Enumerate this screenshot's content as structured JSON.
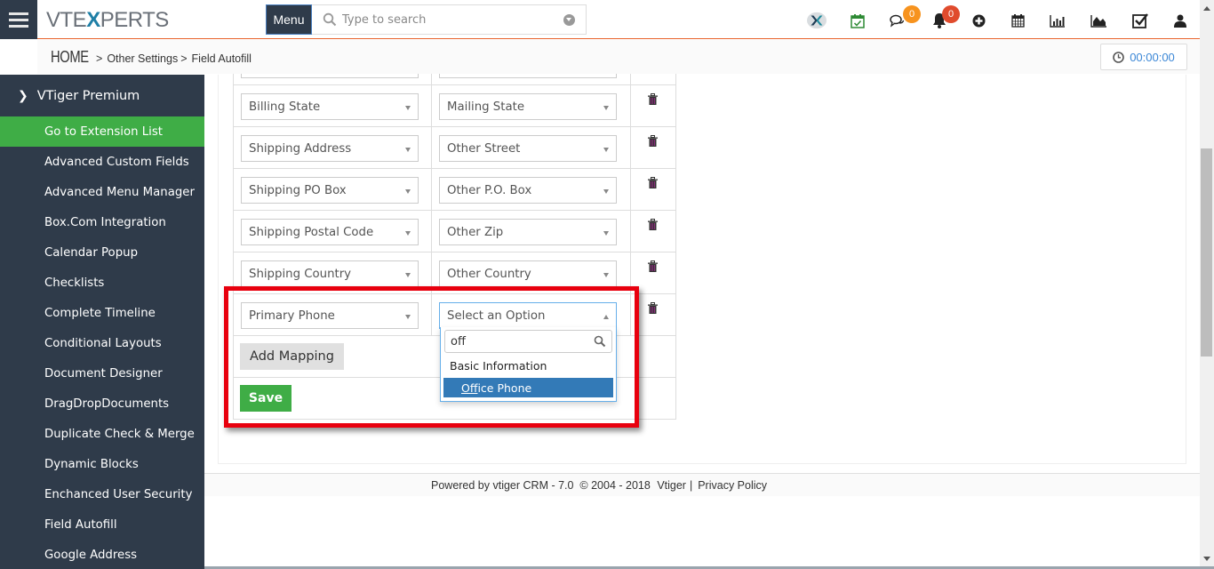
{
  "header": {
    "logo_prefix": "VTE",
    "logo_x": "X",
    "logo_suffix": "PERTS",
    "menu_label": "Menu",
    "search_placeholder": "Type to search",
    "icons": [
      {
        "name": "vtexperts-icon"
      },
      {
        "name": "calendar-check-icon"
      },
      {
        "name": "chat-icon",
        "badge": "0",
        "badge_color": "#f7931e"
      },
      {
        "name": "bell-icon",
        "badge": "0",
        "badge_color": "#e04b2d"
      },
      {
        "name": "plus-circle-icon"
      },
      {
        "name": "calendar-icon"
      },
      {
        "name": "bar-chart-icon"
      },
      {
        "name": "area-chart-icon"
      },
      {
        "name": "task-check-icon"
      },
      {
        "name": "user-icon"
      }
    ]
  },
  "breadcrumb": {
    "home": "HOME",
    "sep": ">",
    "items": [
      "Other Settings",
      "Field Autofill"
    ]
  },
  "timer": "00:00:00",
  "sidebar": {
    "header": "VTiger Premium",
    "items": [
      {
        "label": "Go to Extension List",
        "active": true
      },
      {
        "label": "Advanced Custom Fields"
      },
      {
        "label": "Advanced Menu Manager"
      },
      {
        "label": "Box.Com Integration"
      },
      {
        "label": "Calendar Popup"
      },
      {
        "label": "Checklists"
      },
      {
        "label": "Complete Timeline"
      },
      {
        "label": "Conditional Layouts"
      },
      {
        "label": "Document Designer"
      },
      {
        "label": "DragDropDocuments"
      },
      {
        "label": "Duplicate Check & Merge"
      },
      {
        "label": "Dynamic Blocks"
      },
      {
        "label": "Enchanced User Security"
      },
      {
        "label": "Field Autofill"
      },
      {
        "label": "Google Address"
      }
    ]
  },
  "mappings": [
    {
      "source": "",
      "target": ""
    },
    {
      "source": "Billing State",
      "target": "Mailing State"
    },
    {
      "source": "Shipping Address",
      "target": "Other Street"
    },
    {
      "source": "Shipping PO Box",
      "target": "Other P.O. Box"
    },
    {
      "source": "Shipping Postal Code",
      "target": "Other Zip"
    },
    {
      "source": "Shipping Country",
      "target": "Other Country"
    },
    {
      "source": "Primary Phone",
      "target": "Select an Option"
    }
  ],
  "buttons": {
    "add_mapping": "Add Mapping",
    "save": "Save"
  },
  "dropdown": {
    "search_value": "off",
    "group": "Basic Information",
    "option_match": "Off",
    "option_rest": "ice Phone"
  },
  "footer": {
    "text": "Powered by vtiger CRM - 7.0  © 2004 - 2018 ",
    "vtiger_link": "Vtiger",
    "pipe": "|",
    "privacy_link": "Privacy Policy"
  },
  "colors": {
    "accent_orange": "#e8622a",
    "sidebar_bg": "#2f3b4a",
    "active_green": "#3fad46",
    "highlight_red": "#e8000e",
    "option_blue": "#337ab7"
  }
}
